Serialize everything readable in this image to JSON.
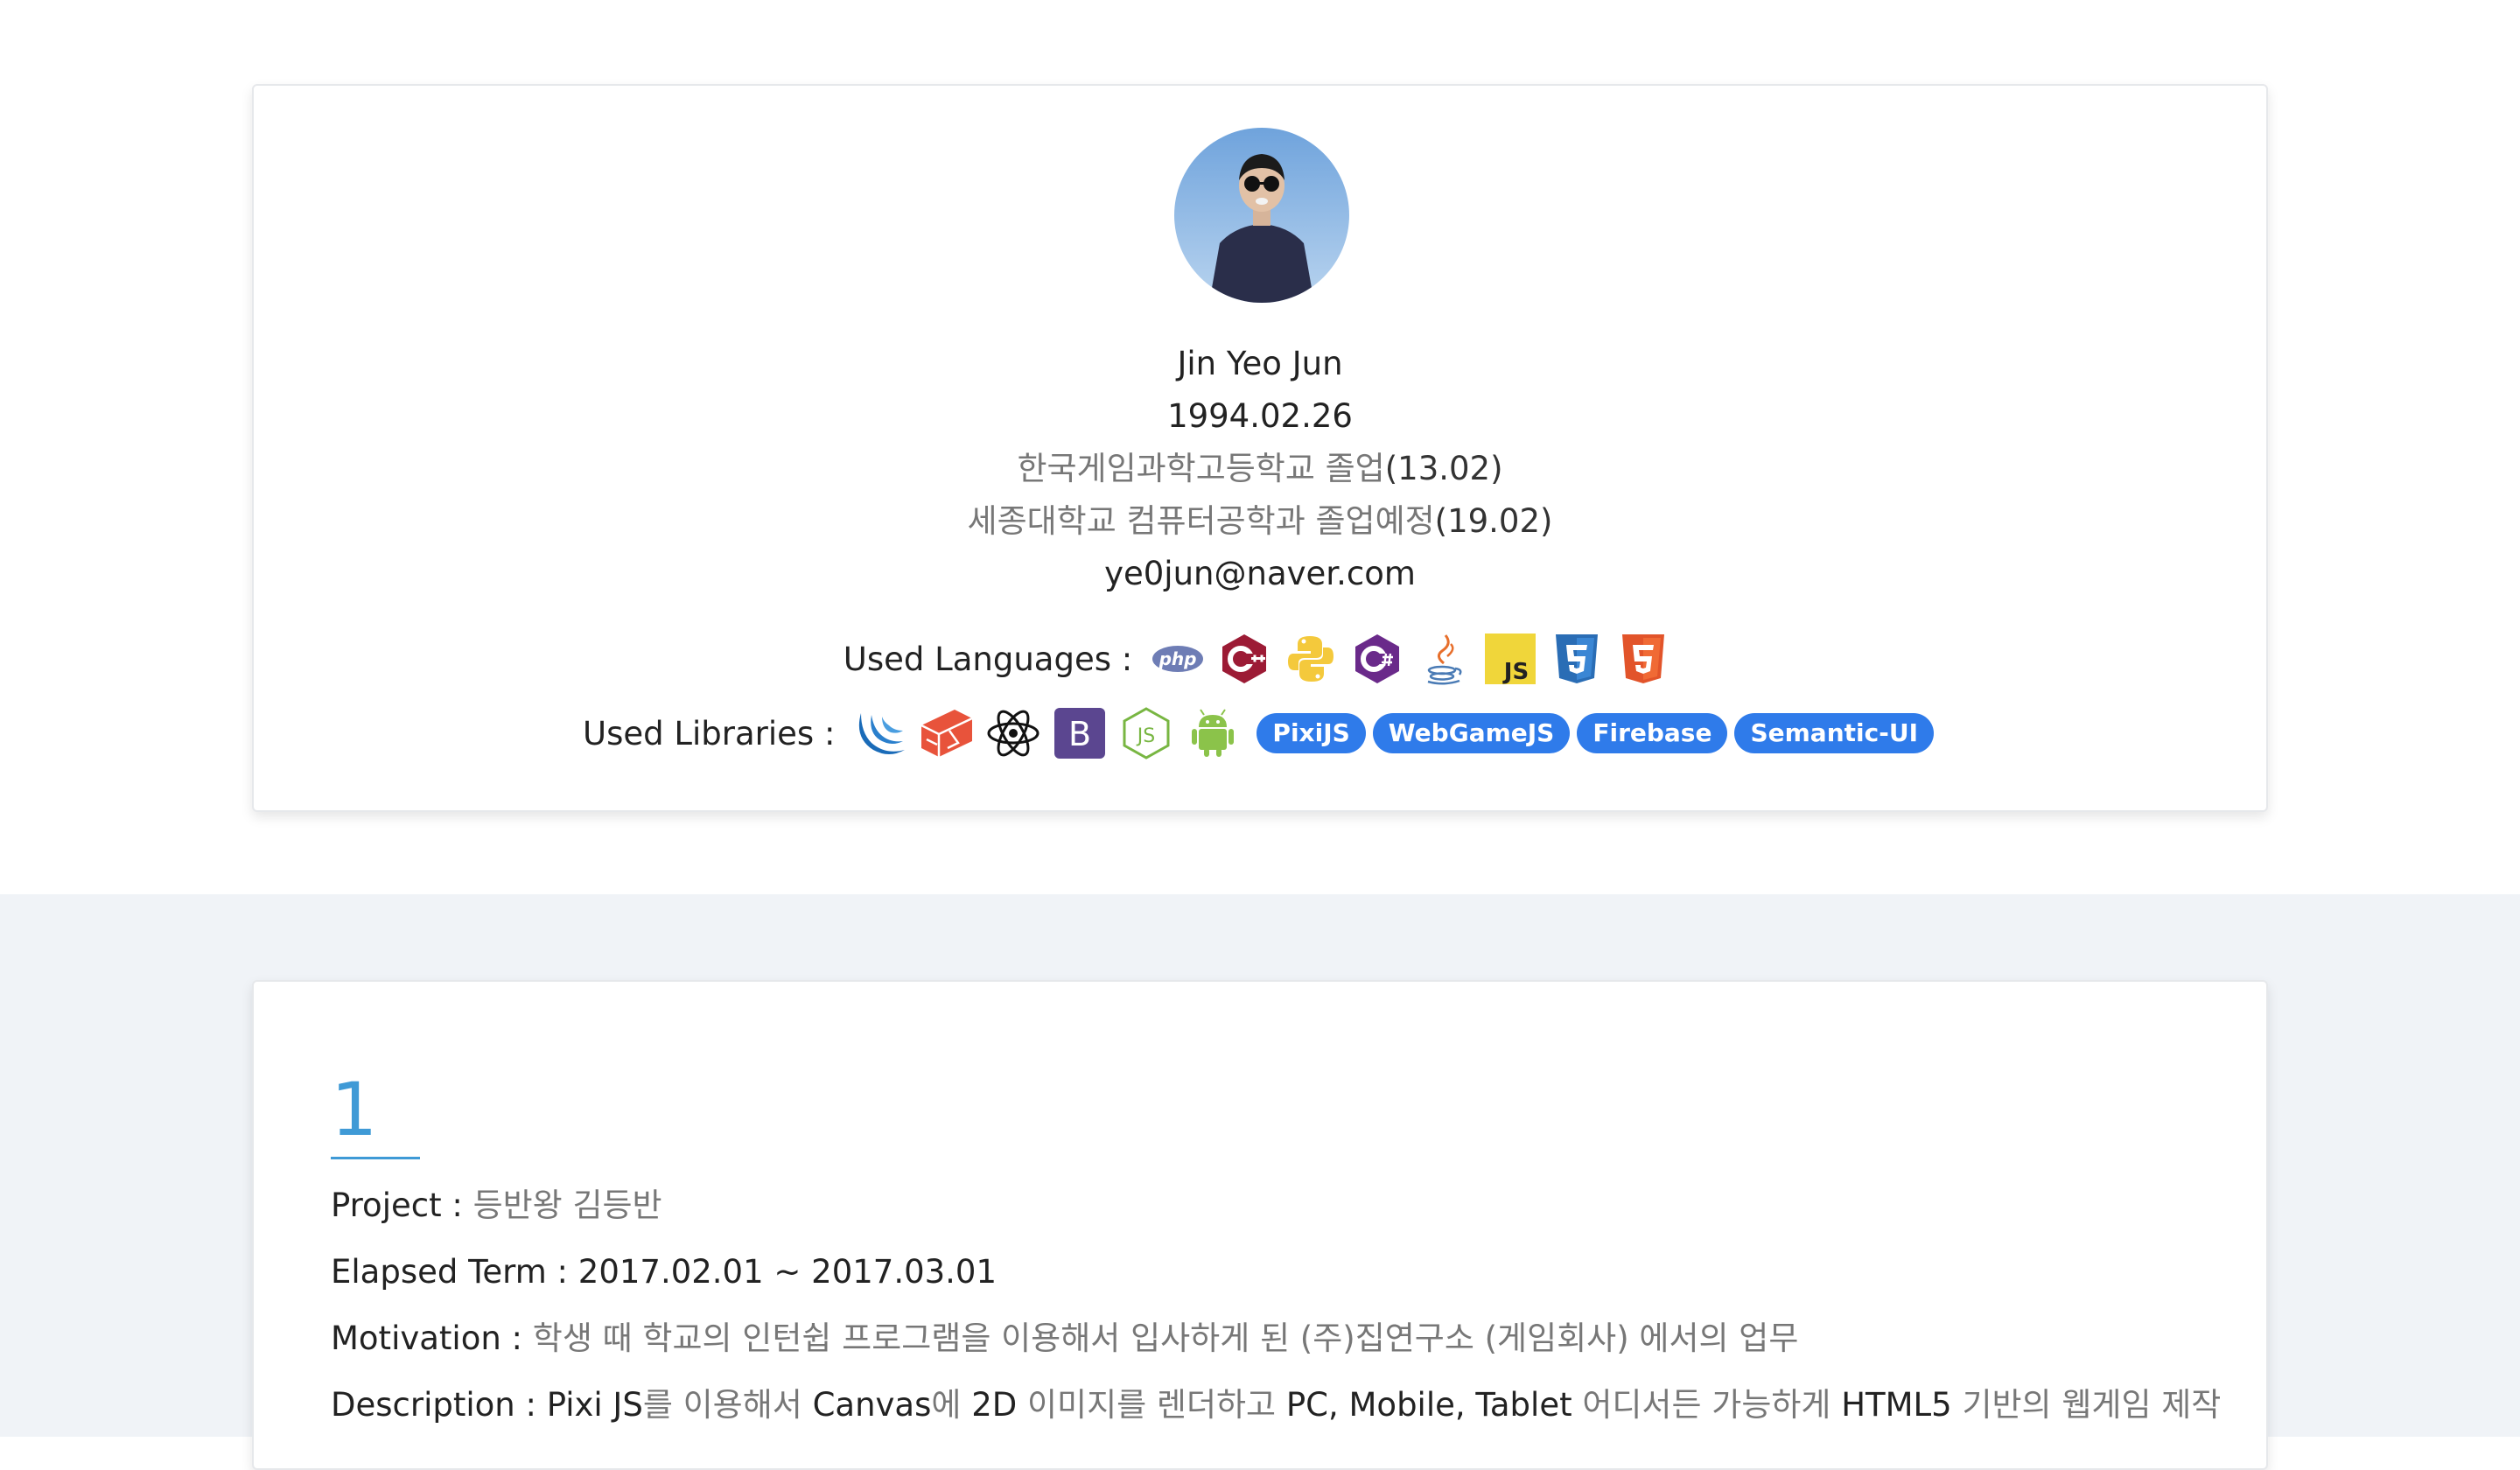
{
  "profile": {
    "name": "Jin Yeo Jun",
    "birth": "1994.02.26",
    "school1_kr": "한국게임과학고등학교 졸업",
    "school1_date": "(13.02)",
    "school2_kr": "세종대학교 컴퓨터공학과 졸업예정",
    "school2_date": "(19.02)",
    "email": "ye0jun@naver.com"
  },
  "languages": {
    "label": "Used Languages :",
    "icons": [
      "php-icon",
      "cplusplus-icon",
      "python-icon",
      "csharp-icon",
      "java-icon",
      "javascript-icon",
      "css3-icon",
      "html5-icon"
    ],
    "php_text": "php",
    "js_text": "JS"
  },
  "libraries": {
    "label": "Used Libraries :",
    "icons": [
      "jquery-icon",
      "laravel-icon",
      "react-icon",
      "bootstrap-icon",
      "nodejs-icon",
      "android-icon"
    ],
    "bootstrap_text": "B",
    "nodejs_text": "JS",
    "pills": [
      "PixiJS",
      "WebGameJS",
      "Firebase",
      "Semantic-UI"
    ]
  },
  "colors": {
    "accent_blue": "#3f9ad6",
    "pill_blue": "#2f7bea",
    "section_gray": "#f0f3f7"
  },
  "project": {
    "number": "1",
    "project_label": "Project : ",
    "project_value": "등반왕 김등반",
    "term_label": "Elapsed Term : ",
    "term_value": "2017.02.01 ~ 2017.03.01",
    "motivation_label": "Motivation : ",
    "motivation_value": "학생 때 학교의 인턴쉽 프로그램을 이용해서 입사하게 된 (주)집연구소 (게임회사) 에서의 업무",
    "description_label": "Description : ",
    "description_parts": [
      "Pixi JS",
      "를 이용해서 ",
      "Canvas",
      "에 ",
      "2D",
      " 이미지를 렌더하고 ",
      "PC, Mobile, Tablet",
      " 어디서든 가능하게 ",
      "HTML5",
      " 기반의 웹게임 제작"
    ]
  }
}
